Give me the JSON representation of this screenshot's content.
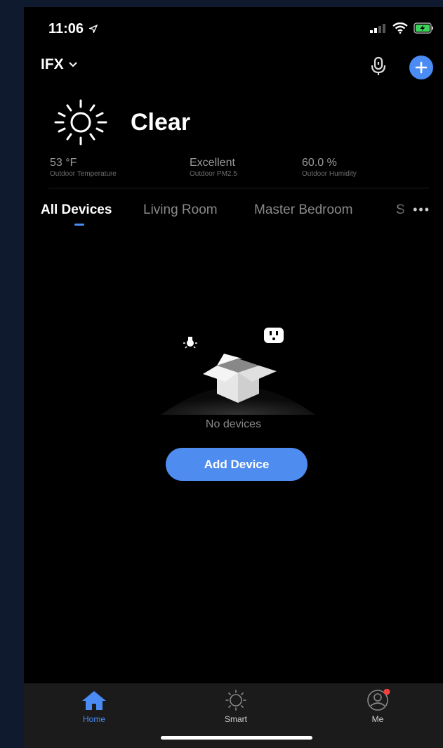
{
  "status_bar": {
    "time": "11:06"
  },
  "header": {
    "home_name": "IFX"
  },
  "weather": {
    "condition": "Clear",
    "stats": [
      {
        "value": "53 °F",
        "label": "Outdoor Temperature"
      },
      {
        "value": "Excellent",
        "label": "Outdoor PM2.5"
      },
      {
        "value": "60.0 %",
        "label": "Outdoor Humidity"
      }
    ]
  },
  "rooms": {
    "tabs": [
      "All Devices",
      "Living Room",
      "Master Bedroom",
      "S"
    ],
    "active": "All Devices"
  },
  "empty_state": {
    "message": "No devices",
    "button": "Add Device"
  },
  "tab_bar": {
    "items": [
      "Home",
      "Smart",
      "Me"
    ],
    "active": "Home"
  },
  "colors": {
    "accent": "#4a8cf4",
    "background": "#000000",
    "tabbar": "#1b1b1b"
  }
}
